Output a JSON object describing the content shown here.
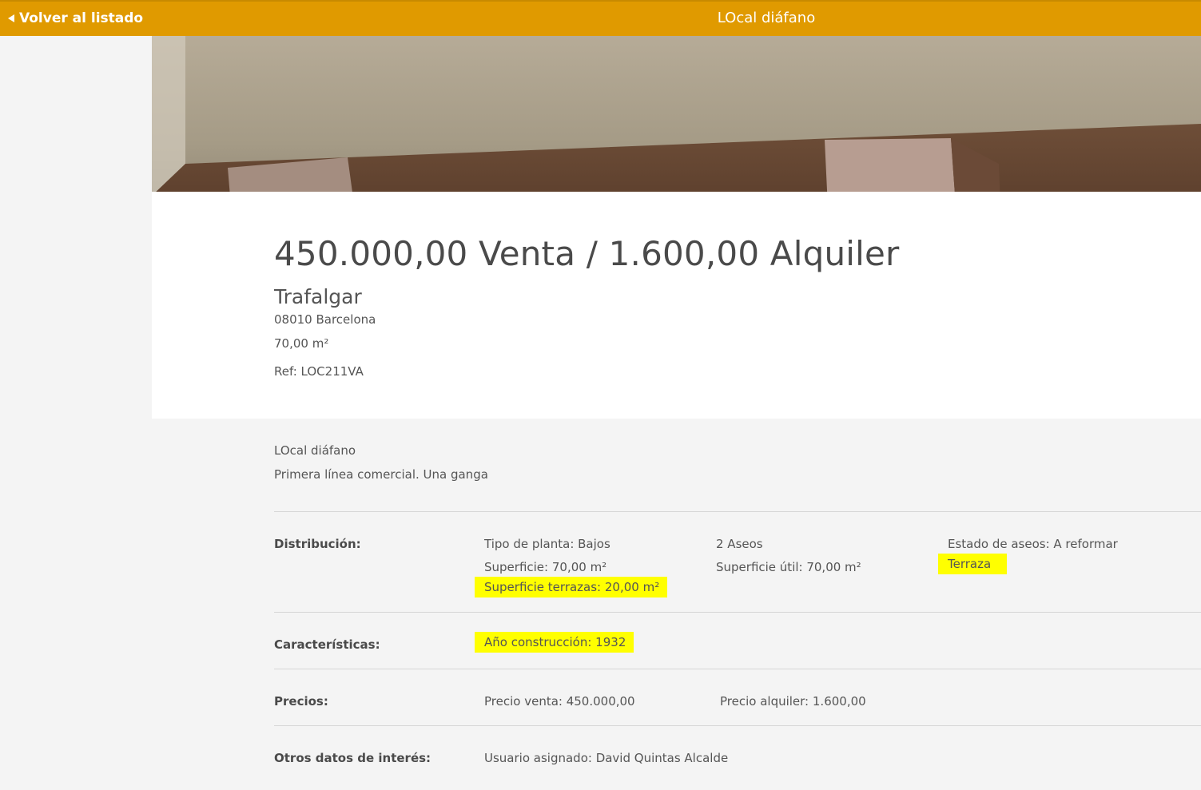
{
  "header": {
    "back_label": "Volver al listado",
    "title": "LOcal diáfano"
  },
  "property": {
    "price_line": "450.000,00 Venta  / 1.600,00 Alquiler",
    "street": "Trafalgar",
    "city": "08010 Barcelona",
    "area": "70,00 m²",
    "ref": "Ref: LOC211VA"
  },
  "description": {
    "title": "LOcal diáfano",
    "text": "Primera línea comercial. Una ganga"
  },
  "sections": {
    "distribucion": {
      "label": "Distribución:",
      "tipo_planta": "Tipo de planta: Bajos",
      "aseos": "2 Aseos",
      "estado_aseos": "Estado de aseos: A reformar",
      "superficie": "Superficie: 70,00 m²",
      "superficie_util": "Superficie útil: 70,00 m²",
      "terraza": "Terraza",
      "superficie_terrazas": "Superficie terrazas: 20,00 m²"
    },
    "caracteristicas": {
      "label": "Características:",
      "anio": "Año construcción: 1932"
    },
    "precios": {
      "label": "Precios:",
      "venta": "Precio venta: 450.000,00",
      "alquiler": "Precio alquiler: 1.600,00"
    },
    "otros": {
      "label": "Otros datos de interés:",
      "usuario": "Usuario asignado: David Quintas Alcalde"
    }
  },
  "colors": {
    "header_bar": "#e09a00",
    "highlight": "#ffff00"
  }
}
